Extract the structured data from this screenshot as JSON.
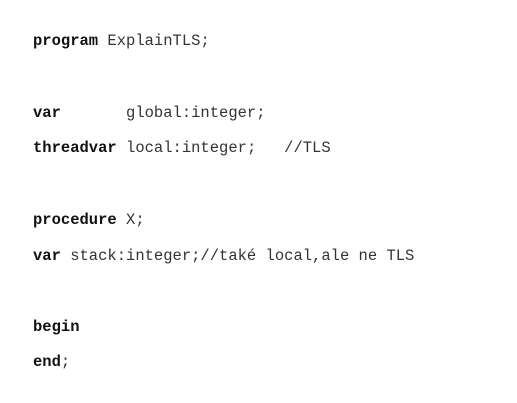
{
  "code": {
    "lines": [
      {
        "keyword": "program",
        "rest": " ExplainTLS;"
      },
      {
        "keyword": "var",
        "rest": "       global:integer;"
      },
      {
        "keyword": "threadvar",
        "rest": " local:integer;   //TLS"
      },
      {
        "keyword": "procedure",
        "rest": " X;"
      },
      {
        "keyword": "var",
        "rest": " stack:integer;//také local,ale ne TLS"
      },
      {
        "keyword": "begin",
        "rest": ""
      },
      {
        "keyword": "end",
        "rest": ";"
      }
    ]
  }
}
